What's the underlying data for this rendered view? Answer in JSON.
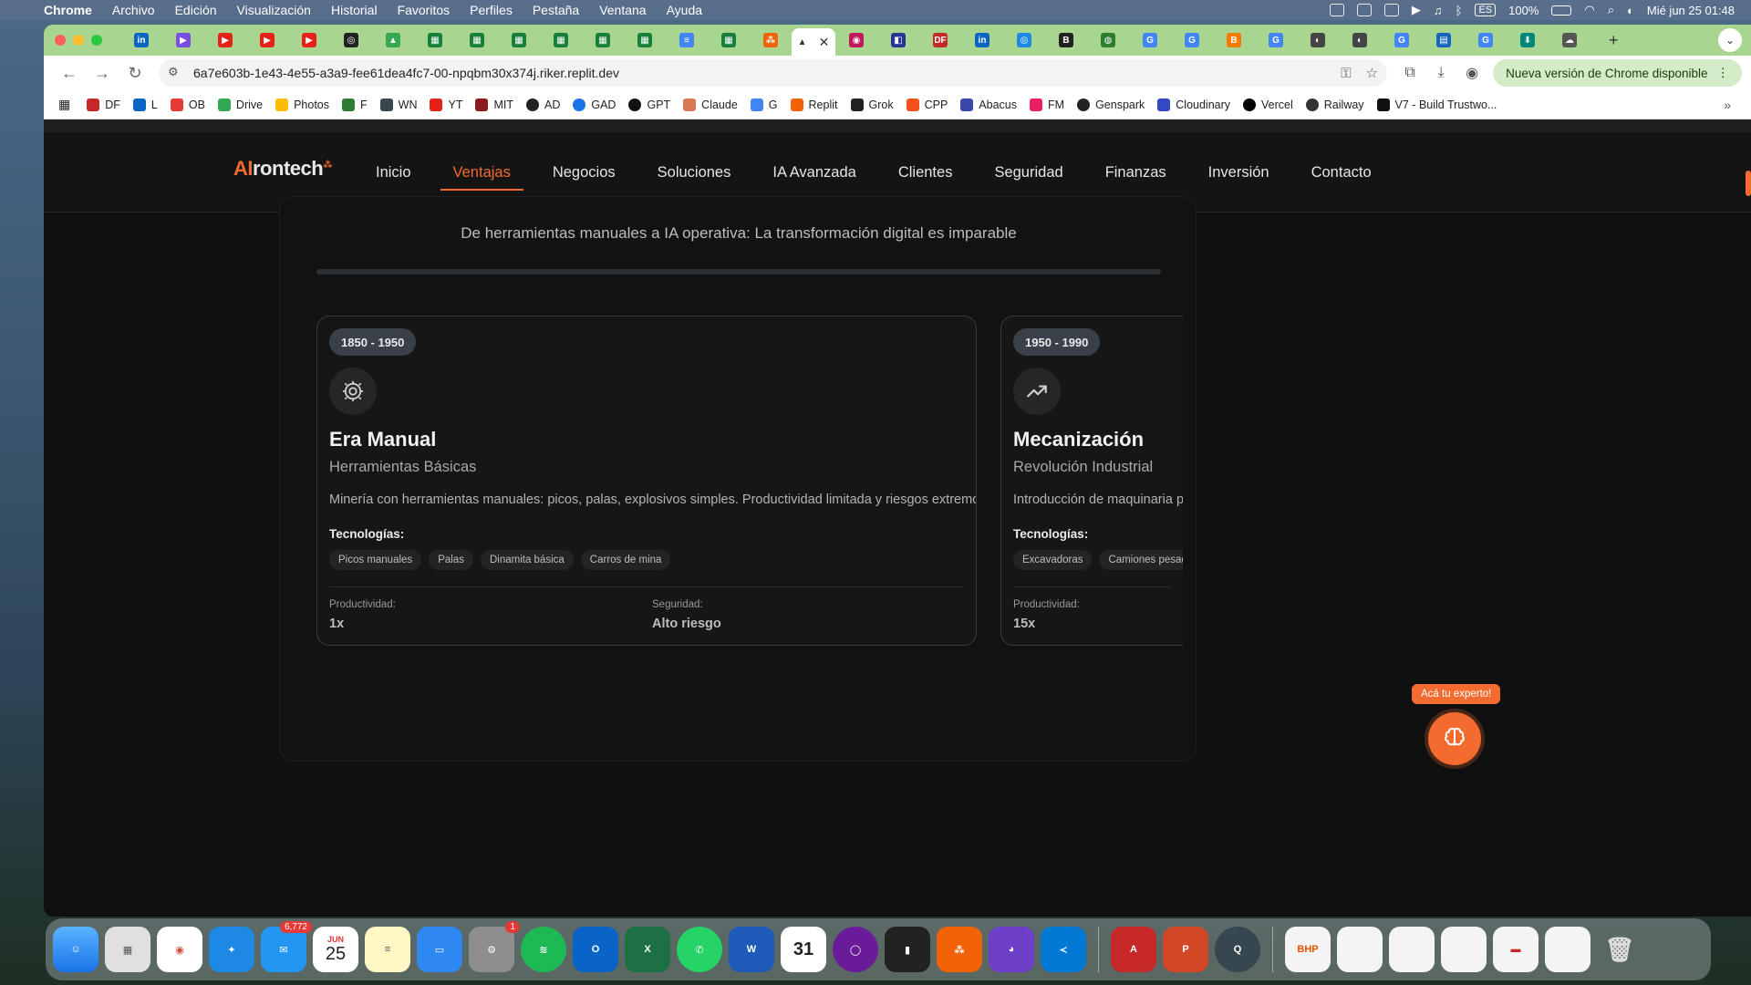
{
  "menubar": {
    "items": [
      "Chrome",
      "Archivo",
      "Edición",
      "Visualización",
      "Historial",
      "Favoritos",
      "Perfiles",
      "Pestaña",
      "Ventana",
      "Ayuda"
    ],
    "battery": "100%",
    "clock": "Mié jun 25  01:48",
    "input_source": "ES"
  },
  "browser": {
    "url": "6a7e603b-1e43-4e55-a3a9-fee61dea4fc7-00-npqbm30x374j.riker.replit.dev",
    "update_label": "Nueva versión de Chrome disponible",
    "bookmarks": [
      "DF",
      "L",
      "OB",
      "Drive",
      "Photos",
      "F",
      "WN",
      "YT",
      "MIT",
      "AD",
      "GAD",
      "GPT",
      "Claude",
      "G",
      "Replit",
      "Grok",
      "CPP",
      "Abacus",
      "FM",
      "Genspark",
      "Cloudinary",
      "Vercel",
      "Railway",
      "V7 - Build Trustwo..."
    ]
  },
  "site": {
    "logo_ai": "AI",
    "logo_rest": "rontech",
    "nav": [
      "Inicio",
      "Ventajas",
      "Negocios",
      "Soluciones",
      "IA Avanzada",
      "Clientes",
      "Seguridad",
      "Finanzas",
      "Inversión",
      "Contacto"
    ],
    "active_nav": "Ventajas"
  },
  "section": {
    "subtitle": "De herramientas manuales a IA operativa: La transformación digital es imparable",
    "progress": 0.0
  },
  "cards": [
    {
      "era": "1850 - 1950",
      "title": "Era Manual",
      "subtitle": "Herramientas Básicas",
      "description": "Minería con herramientas manuales: picos, palas, explosivos simples. Productividad limitada y riesgos extremos.",
      "tech_label": "Tecnologías:",
      "tags": [
        "Picos manuales",
        "Palas",
        "Dinamita básica",
        "Carros de mina"
      ],
      "productivity_label": "Productividad:",
      "productivity": "1x",
      "safety_label": "Seguridad:",
      "safety": "Alto riesgo",
      "icon": "gear-icon"
    },
    {
      "era": "1950 - 1990",
      "title": "Mecanización",
      "subtitle": "Revolución Industrial",
      "description": "Introducción de maquinaria p",
      "tech_label": "Tecnologías:",
      "tags": [
        "Excavadoras",
        "Camiones pesad"
      ],
      "productivity_label": "Productividad:",
      "productivity": "15x",
      "icon": "trending-up-icon"
    }
  ],
  "expert": {
    "label": "Acá tu experto!"
  },
  "dock": {
    "mail_badge": "6,772",
    "settings_badge": "1",
    "calendar_month": "JUN",
    "calendar_day": "25",
    "calendar_day2": "31"
  },
  "colors": {
    "accent": "#f36b2f",
    "tab_strip": "#a8d590",
    "page_bg": "#101010"
  }
}
